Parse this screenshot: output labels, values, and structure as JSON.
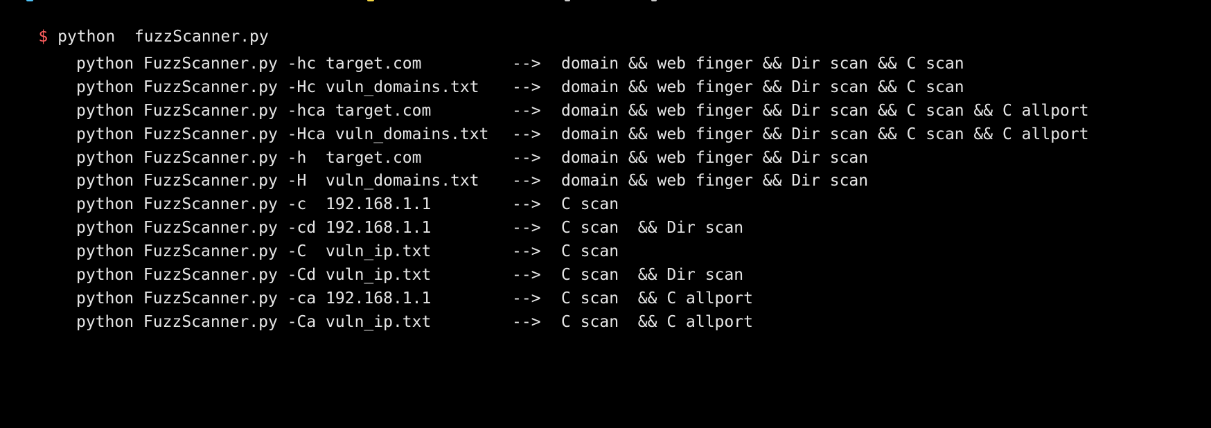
{
  "terminal": {
    "prompt_symbol": "$",
    "command": " python  fuzzScanner.py",
    "usage_lines": [
      {
        "cmd": "python FuzzScanner.py -hc target.com",
        "arrow": "-->",
        "desc": "domain && web finger && Dir scan && C scan"
      },
      {
        "cmd": "python FuzzScanner.py -Hc vuln_domains.txt",
        "arrow": "-->",
        "desc": "domain && web finger && Dir scan && C scan"
      },
      {
        "cmd": "python FuzzScanner.py -hca target.com",
        "arrow": "-->",
        "desc": "domain && web finger && Dir scan && C scan && C allport"
      },
      {
        "cmd": "python FuzzScanner.py -Hca vuln_domains.txt",
        "arrow": "-->",
        "desc": "domain && web finger && Dir scan && C scan && C allport"
      },
      {
        "cmd": "python FuzzScanner.py -h  target.com",
        "arrow": "-->",
        "desc": "domain && web finger && Dir scan"
      },
      {
        "cmd": "python FuzzScanner.py -H  vuln_domains.txt",
        "arrow": "-->",
        "desc": "domain && web finger && Dir scan"
      },
      {
        "cmd": "python FuzzScanner.py -c  192.168.1.1",
        "arrow": "-->",
        "desc": "C scan"
      },
      {
        "cmd": "python FuzzScanner.py -cd 192.168.1.1",
        "arrow": "-->",
        "desc": "C scan  && Dir scan"
      },
      {
        "cmd": "python FuzzScanner.py -C  vuln_ip.txt",
        "arrow": "-->",
        "desc": "C scan"
      },
      {
        "cmd": "python FuzzScanner.py -Cd vuln_ip.txt",
        "arrow": "-->",
        "desc": "C scan  && Dir scan"
      },
      {
        "cmd": "python FuzzScanner.py -ca 192.168.1.1",
        "arrow": "-->",
        "desc": "C scan  && C allport"
      },
      {
        "cmd": "python FuzzScanner.py -Ca vuln_ip.txt",
        "arrow": "-->",
        "desc": "C scan  && C allport"
      }
    ]
  },
  "colors": {
    "background": "#000000",
    "text": "#e6e6e6",
    "prompt": "#ff5f5f",
    "prev_line_cyan": "#4fc3f7",
    "prev_line_yellow": "#f5d742",
    "prev_line_white": "#cccccc"
  }
}
